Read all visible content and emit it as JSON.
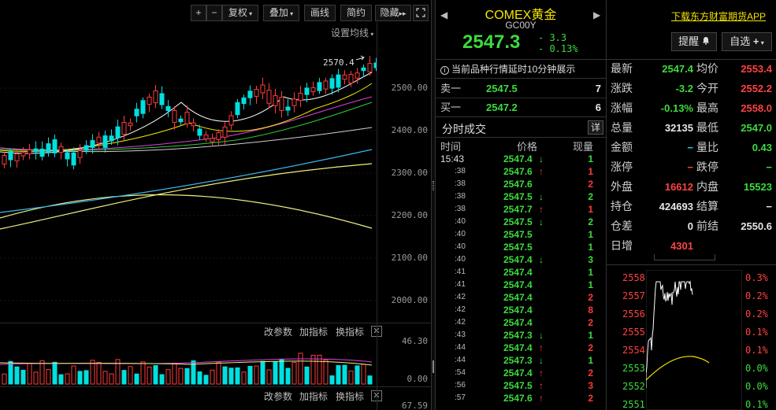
{
  "toolbar": {
    "zoom_in": "+",
    "zoom_out": "−",
    "fuquan": "复权",
    "diejia": "叠加",
    "huaxian": "画线",
    "jianyue": "简约",
    "yincang": "隐藏",
    "more": "▸▸"
  },
  "main_chart": {
    "ma_settings": "设置均线",
    "high_annotation": "2570.4",
    "y_ticks": [
      "2500.00",
      "2400.00",
      "2300.00",
      "2200.00",
      "2100.00",
      "2000.00"
    ],
    "ind1": {
      "change_params": "改参数",
      "add": "加指标",
      "swap": "换指标",
      "close": "✕"
    },
    "vol_ticks": [
      "46.30",
      "0.00"
    ],
    "ind2": {
      "change_params": "改参数",
      "add": "加指标",
      "swap": "换指标",
      "close": "✕"
    },
    "ind2_tick": "67.59"
  },
  "quote": {
    "name": "COMEX黄金",
    "code": "GC00Y",
    "price": "2547.3",
    "change": "- 3.3",
    "change_pct": "- 0.13%",
    "delay_notice": "当前品种行情延时10分钟展示",
    "sell1_label": "卖一",
    "sell1_price": "2547.5",
    "sell1_vol": "7",
    "buy1_label": "买一",
    "buy1_price": "2547.2",
    "buy1_vol": "6",
    "ticks_title": "分时成交",
    "ticks_detail": "详",
    "col_time": "时间",
    "col_price": "价格",
    "col_vol": "现量"
  },
  "ticks": [
    {
      "time": "15:43",
      "price": "2547.4",
      "dir": "down",
      "vol": "1"
    },
    {
      "time": ":38",
      "price": "2547.6",
      "dir": "up",
      "vol": "1"
    },
    {
      "time": ":38",
      "price": "2547.6",
      "dir": "none",
      "vol": "2"
    },
    {
      "time": ":38",
      "price": "2547.5",
      "dir": "down",
      "vol": "2"
    },
    {
      "time": ":38",
      "price": "2547.7",
      "dir": "up",
      "vol": "1"
    },
    {
      "time": ":40",
      "price": "2547.5",
      "dir": "down",
      "vol": "2"
    },
    {
      "time": ":40",
      "price": "2547.5",
      "dir": "none",
      "vol": "1"
    },
    {
      "time": ":40",
      "price": "2547.5",
      "dir": "none",
      "vol": "1"
    },
    {
      "time": ":40",
      "price": "2547.4",
      "dir": "down",
      "vol": "3"
    },
    {
      "time": ":41",
      "price": "2547.4",
      "dir": "none",
      "vol": "1"
    },
    {
      "time": ":41",
      "price": "2547.4",
      "dir": "none",
      "vol": "1"
    },
    {
      "time": ":42",
      "price": "2547.4",
      "dir": "none",
      "vol": "2"
    },
    {
      "time": ":42",
      "price": "2547.4",
      "dir": "none",
      "vol": "8"
    },
    {
      "time": ":42",
      "price": "2547.4",
      "dir": "none",
      "vol": "2"
    },
    {
      "time": ":43",
      "price": "2547.3",
      "dir": "down",
      "vol": "1"
    },
    {
      "time": ":44",
      "price": "2547.4",
      "dir": "up",
      "vol": "2"
    },
    {
      "time": ":44",
      "price": "2547.3",
      "dir": "down",
      "vol": "1"
    },
    {
      "time": ":54",
      "price": "2547.4",
      "dir": "up",
      "vol": "2"
    },
    {
      "time": ":56",
      "price": "2547.5",
      "dir": "up",
      "vol": "3"
    },
    {
      "time": ":57",
      "price": "2547.6",
      "dir": "up",
      "vol": "2"
    }
  ],
  "right": {
    "download": "下载东方财富期货APP",
    "alert": "提醒",
    "watchlist": "自选",
    "stats": [
      {
        "k1": "最新",
        "v1": "2547.4",
        "c1": "green",
        "k2": "均价",
        "v2": "2553.4",
        "c2": "red"
      },
      {
        "k1": "涨跌",
        "v1": "-3.2",
        "c1": "green",
        "k2": "今开",
        "v2": "2552.2",
        "c2": "red"
      },
      {
        "k1": "涨幅",
        "v1": "-0.13%",
        "c1": "green",
        "k2": "最高",
        "v2": "2558.0",
        "c2": "red"
      },
      {
        "k1": "总量",
        "v1": "32135",
        "c1": "white",
        "k2": "最低",
        "v2": "2547.0",
        "c2": "green"
      },
      {
        "k1": "金额",
        "v1": "−",
        "c1": "cyan",
        "k2": "量比",
        "v2": "0.43",
        "c2": "green"
      },
      {
        "k1": "涨停",
        "v1": "−",
        "c1": "red",
        "k2": "跌停",
        "v2": "−",
        "c2": "green"
      },
      {
        "k1": "外盘",
        "v1": "16612",
        "c1": "red",
        "k2": "内盘",
        "v2": "15523",
        "c2": "green"
      },
      {
        "k1": "持仓",
        "v1": "424693",
        "c1": "white",
        "k2": "结算",
        "v2": "−",
        "c2": "white"
      },
      {
        "k1": "仓差",
        "v1": "0",
        "c1": "white",
        "k2": "前结",
        "v2": "2550.6",
        "c2": "white"
      },
      {
        "k1": "日增",
        "v1": "4301",
        "c1": "red",
        "k2": "",
        "v2": "",
        "c2": "white"
      }
    ],
    "mini_y_left": [
      "2558",
      "2557",
      "2556",
      "2555",
      "2554",
      "2553",
      "2552",
      "2551"
    ],
    "mini_y_right": [
      "0.3%",
      "0.2%",
      "0.2%",
      "0.1%",
      "0.1%",
      "0.0%",
      "0.0%",
      "0.1%"
    ]
  },
  "colors": {
    "up": "#ff3b3b",
    "down": "#3ddb3d",
    "accent": "#f5e400"
  }
}
